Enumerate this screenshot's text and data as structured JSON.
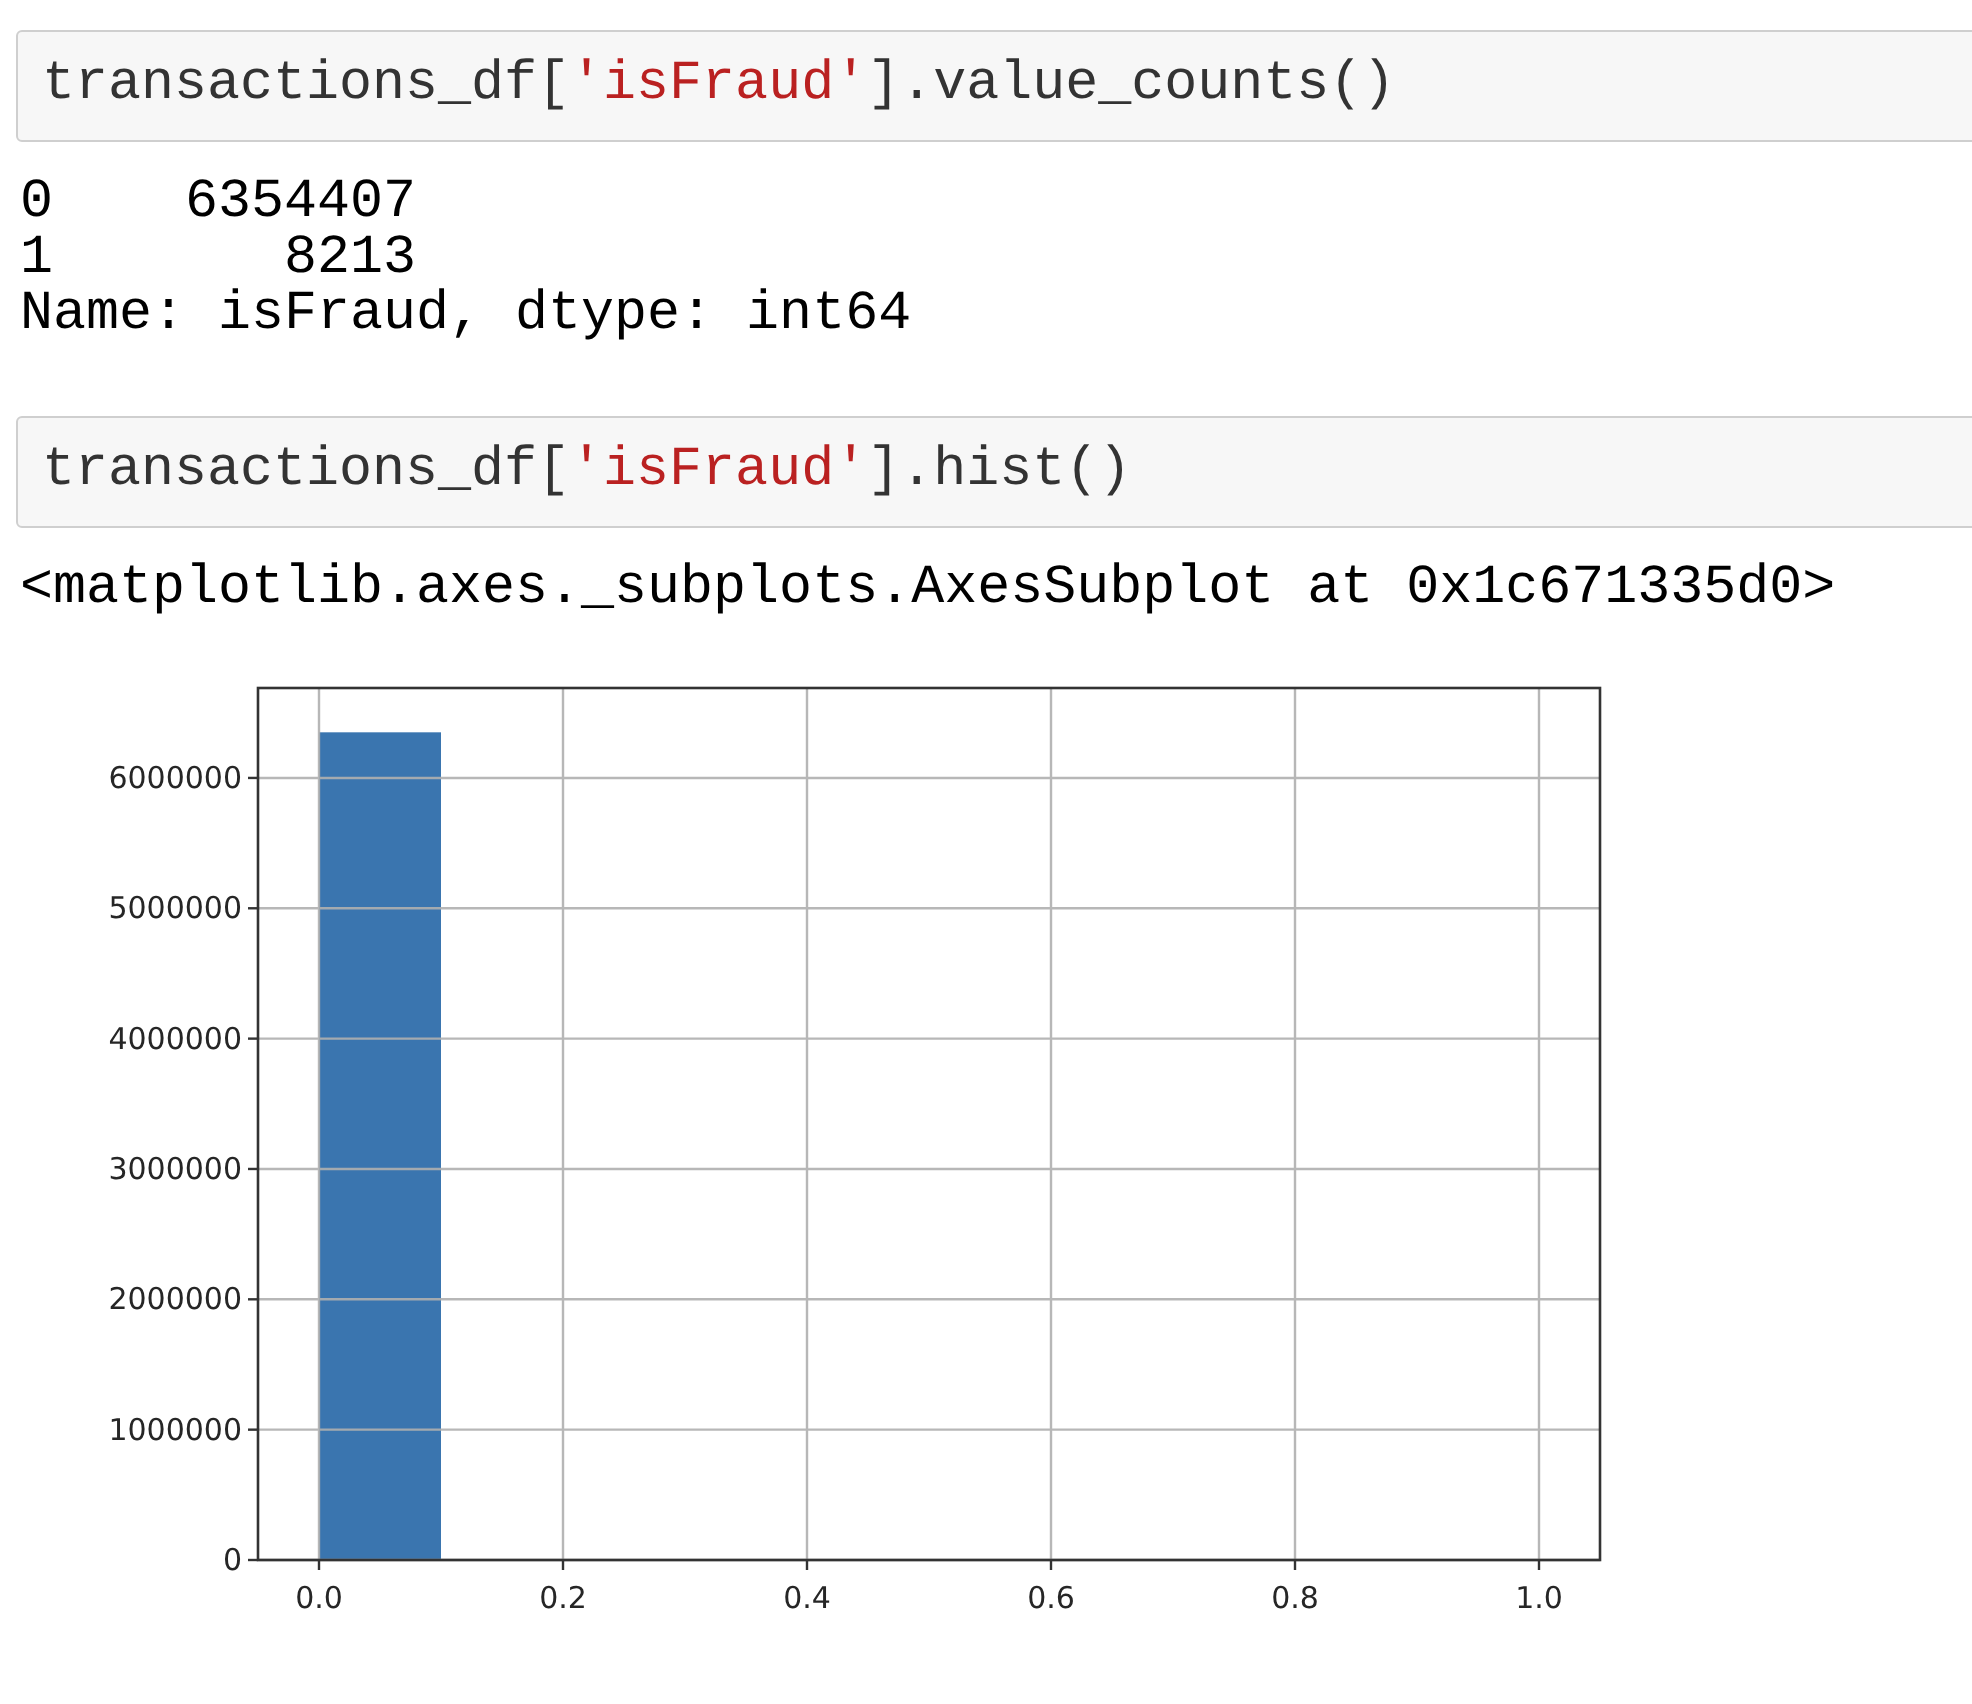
{
  "cells": [
    {
      "kind": "input",
      "code": [
        {
          "kind": "plain",
          "text": "transactions_df["
        },
        {
          "kind": "string",
          "text": "'isFraud'"
        },
        {
          "kind": "plain",
          "text": "].value_counts()"
        }
      ]
    },
    {
      "kind": "text_output",
      "lines": [
        "0    6354407",
        "1       8213",
        "Name: isFraud, dtype: int64"
      ]
    },
    {
      "kind": "input",
      "code": [
        {
          "kind": "plain",
          "text": "transactions_df["
        },
        {
          "kind": "string",
          "text": "'isFraud'"
        },
        {
          "kind": "plain",
          "text": "].hist()"
        }
      ]
    },
    {
      "kind": "text_output",
      "lines": [
        "<matplotlib.axes._subplots.AxesSubplot at 0x1c671335d0>"
      ]
    },
    {
      "kind": "chart_output",
      "chart_data": {
        "type": "bar",
        "grid": true,
        "x": [
          0.05,
          0.15,
          0.25,
          0.35,
          0.45,
          0.55,
          0.65,
          0.75,
          0.85,
          0.95
        ],
        "series": [
          {
            "color": "#3a75af",
            "values": [
              6350000,
              0,
              0,
              0,
              0,
              0,
              0,
              0,
              0,
              0
            ]
          }
        ],
        "xlim": [
          -0.05,
          1.05
        ],
        "ylim": [
          0,
          6690000
        ],
        "xticks": [
          {
            "value": 0,
            "label": "0.0"
          },
          {
            "value": 0.2,
            "label": "0.2"
          },
          {
            "value": 0.4,
            "label": "0.4"
          },
          {
            "value": 0.6,
            "label": "0.6"
          },
          {
            "value": 0.8,
            "label": "0.8"
          },
          {
            "value": 1,
            "label": "1.0"
          }
        ],
        "yticks": [
          0,
          1000000,
          2000000,
          3000000,
          4000000,
          5000000,
          6000000
        ]
      }
    }
  ]
}
